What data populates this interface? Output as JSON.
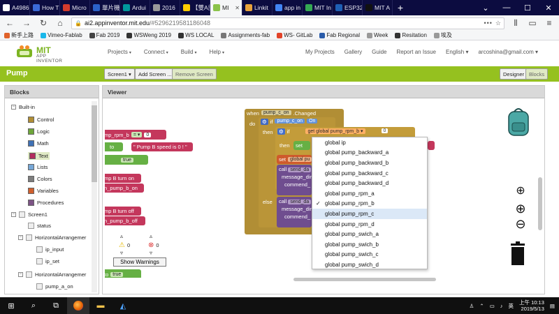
{
  "browser": {
    "tabs": [
      {
        "label": "A4986",
        "color": "#ffffff"
      },
      {
        "label": "How T",
        "color": "#3b6ad6"
      },
      {
        "label": "Micro",
        "color": "#d33b2c"
      },
      {
        "label": "單片機學",
        "color": "#2b62c9"
      },
      {
        "label": "Ardui",
        "color": "#00979c"
      },
      {
        "label": "2016",
        "color": "#999999"
      },
      {
        "label": "【雙A計劃",
        "color": "#ffcc00"
      },
      {
        "label": "MI",
        "color": "#8bc34a",
        "active": true
      },
      {
        "label": "Linkit",
        "color": "#e8a33b"
      },
      {
        "label": "app in",
        "color": "#4285f4"
      },
      {
        "label": "MIT In",
        "color": "#34a853"
      },
      {
        "label": "ESP32",
        "color": "#1e5fb4"
      },
      {
        "label": "MIT A",
        "color": "#111111"
      }
    ],
    "new_tab": "+",
    "url_host": "ai2.appinventor.mit.edu",
    "url_path": "/#5296219581186048",
    "url_more": "•••",
    "bookmarks": [
      {
        "label": "新手上路",
        "color": "#e0622a"
      },
      {
        "label": "Vimeo-Fablab",
        "color": "#1ab7ea"
      },
      {
        "label": "Fab 2019",
        "color": "#444444"
      },
      {
        "label": "WSWeng 2019",
        "color": "#333333"
      },
      {
        "label": "WS LOCAL",
        "color": "#333333"
      },
      {
        "label": "Assignments-fab",
        "color": "#777777"
      },
      {
        "label": "WS- GitLab",
        "color": "#e24329"
      },
      {
        "label": "Fab Regional",
        "color": "#2a5caa"
      },
      {
        "label": "Week",
        "color": "#999999"
      },
      {
        "label": "Resitation",
        "color": "#333333"
      },
      {
        "label": "埃及",
        "color": "#999999"
      }
    ]
  },
  "app": {
    "logo_top": "MIT",
    "logo_bottom": "APP INVENTOR",
    "menu": [
      "Projects",
      "Connect",
      "Build",
      "Help"
    ],
    "right_links": [
      "My Projects",
      "Gallery",
      "Guide",
      "Report an Issue",
      "English",
      "arcoshina@gmail.com"
    ],
    "project_name": "Pump",
    "screen_button": "Screen1 ▾",
    "add_screen": "Add Screen ...",
    "remove_screen": "Remove Screen",
    "designer": "Designer",
    "blocks_btn": "Blocks",
    "brand_green": "#95c11f"
  },
  "blocks_panel": {
    "title": "Blocks",
    "builtin": "Built-in",
    "categories": [
      {
        "label": "Control",
        "color": "#b18e35"
      },
      {
        "label": "Logic",
        "color": "#6ea63a"
      },
      {
        "label": "Math",
        "color": "#3f71b5"
      },
      {
        "label": "Text",
        "color": "#b32d5e"
      },
      {
        "label": "Lists",
        "color": "#76a7d6"
      },
      {
        "label": "Colors",
        "color": "#7d7d7d"
      },
      {
        "label": "Variables",
        "color": "#d05f2d"
      },
      {
        "label": "Procedures",
        "color": "#7c5385"
      }
    ],
    "screen": "Screen1",
    "components": [
      "status",
      "HorizontalArrangemer",
      "ip_input",
      "ip_set",
      "HorizontalArrangemer",
      "pump_a_on"
    ]
  },
  "viewer": {
    "title": "Viewer",
    "blocks": {
      "rpm_b": "mp_rpm_b",
      "eq": "= ▾",
      "zero": "0",
      "to": "to",
      "speed_text": "\" Pump B speed is 0 ! \"",
      "true1": "true",
      "turn_on": "mp B turn on",
      "pump_b_on": "n_pump_b_on",
      "turn_off": "mp B turn off",
      "pump_b_off": "n_pump_b_off",
      "to2": "to",
      "true2": "true",
      "when": "when",
      "when_comp": "pump_c_on",
      "changed": ".Changed",
      "do": "do",
      "if1": "if",
      "pump_c_on": "pump_c_on",
      "on": "On",
      "then": "then",
      "if2": "if",
      "get": "get",
      "get_var": "global pump_rpm_b",
      "zero2": "0",
      "then2": "then",
      "set": "set",
      "set_label": "set",
      "set_var": "global pu",
      "call": "call",
      "send_da": "send_da",
      "message_dir": "message_dir",
      "command": "commend_",
      "else": "else",
      "call2": "call",
      "send_da2": "send_da",
      "message_dir2": "message_dir",
      "command2": "commend_"
    },
    "dropdown": {
      "items": [
        "global ip",
        "global pump_backward_a",
        "global pump_backward_b",
        "global pump_backward_c",
        "global pump_backward_d",
        "global pump_rpm_a",
        "global pump_rpm_b",
        "global pump_rpm_c",
        "global pump_rpm_d",
        "global pump_swich_a",
        "global pump_swich_b",
        "global pump_swich_c",
        "global pump_swich_d"
      ],
      "checked_index": 6,
      "highlighted_index": 7
    },
    "warnings_count": "0",
    "errors_count": "0",
    "show_warnings": "Show Warnings"
  },
  "taskbar": {
    "ime": "英",
    "clock_top": "上午 10:13",
    "clock_bottom": "2019/5/13"
  }
}
